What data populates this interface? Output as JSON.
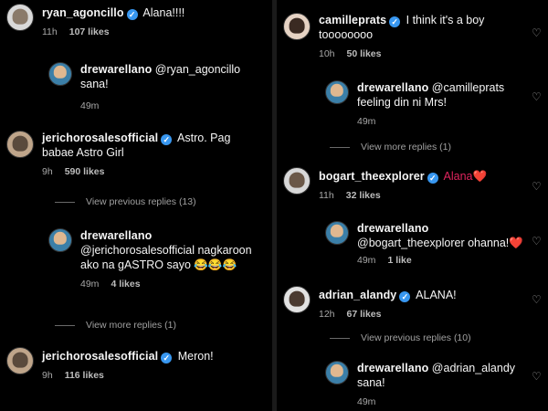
{
  "left": {
    "c1": {
      "username": "ryan_agoncillo",
      "text": "Alana!!!!",
      "time": "11h",
      "likes": "107 likes"
    },
    "r1": {
      "username": "drewarellano",
      "text": "@ryan_agoncillo sana!",
      "time": "49m"
    },
    "c2": {
      "username": "jerichorosalesofficial",
      "text": "Astro. Pag babae Astro Girl",
      "time": "9h",
      "likes": "590 likes"
    },
    "vr1": "View previous replies (13)",
    "r2": {
      "username": "drewarellano",
      "text": "@jerichorosalesofficial nagkaroon ako na gASTRO sayo 😂😂😂",
      "time": "49m",
      "likes": "4 likes"
    },
    "vr2": "View more replies (1)",
    "c3": {
      "username": "jerichorosalesofficial",
      "text": "Meron!",
      "time": "9h",
      "likes": "116 likes"
    }
  },
  "right": {
    "c1": {
      "username": "camilleprats",
      "text": "I think it's a boy toooooooo",
      "time": "10h",
      "likes": "50 likes"
    },
    "r1": {
      "username": "drewarellano",
      "text": "@camilleprats feeling din ni Mrs!",
      "time": "49m"
    },
    "vr1": "View more replies (1)",
    "c2": {
      "username": "bogart_theexplorer",
      "text": "Alana❤️",
      "time": "11h",
      "likes": "32 likes"
    },
    "r2": {
      "username": "drewarellano",
      "text": "@bogart_theexplorer ohanna!❤️",
      "time": "49m",
      "likes": "1 like"
    },
    "c3": {
      "username": "adrian_alandy",
      "text": "ALANA!",
      "time": "12h",
      "likes": "67 likes"
    },
    "vr2": "View previous replies (10)",
    "r3": {
      "username": "drewarellano",
      "text": "@adrian_alandy sana!",
      "time": "49m"
    }
  },
  "icons": {
    "verified": "verified-badge-icon",
    "like": "heart-outline-icon"
  },
  "colors": {
    "background": "#000000",
    "verified": "#3897f0",
    "meta": "#a8a8a8"
  }
}
